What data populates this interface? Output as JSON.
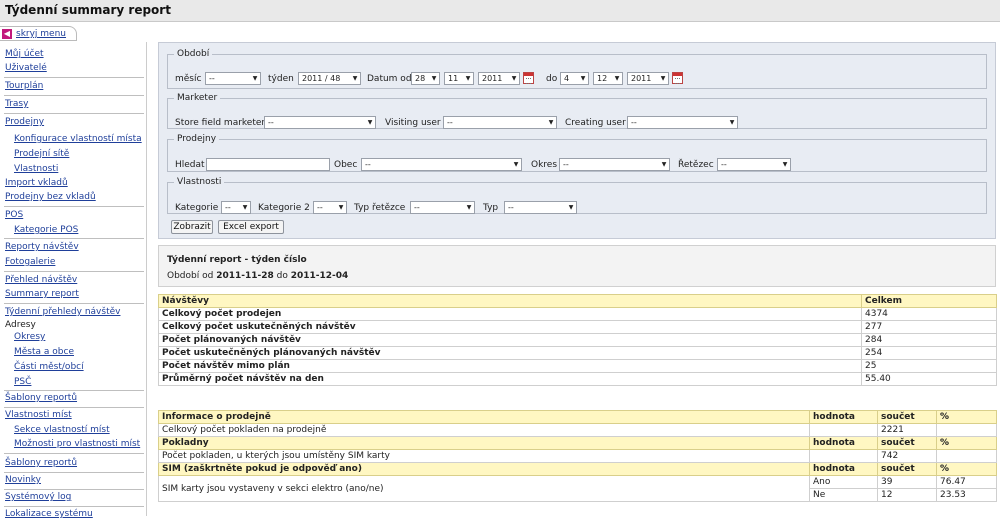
{
  "window": {
    "title": "Týdenní summary report"
  },
  "menu_toggle": {
    "label": "skryj menu"
  },
  "sidebar": {
    "items": [
      "Můj účet",
      "Uživatelé",
      "Tourplán",
      "Trasy",
      "Prodejny",
      "Konfigurace vlastností místa",
      "Prodejní sítě",
      "Vlastnosti",
      "Import vkladů",
      "Prodejny bez vkladů",
      "POS",
      "Kategorie POS",
      "Reporty návštěv",
      "Fotogalerie",
      "Přehled návštěv",
      "Summary report",
      "Týdenní přehledy návštěv",
      "Adresy",
      "Okresy",
      "Města a obce",
      "Části měst/obcí",
      "PSČ",
      "Šablony reportů",
      "Vlastnosti míst",
      "Sekce vlastností míst",
      "Možnosti pro vlastnosti míst",
      "Šablony reportů",
      "Novinky",
      "Systémový log",
      "Lokalizace systému"
    ]
  },
  "filters": {
    "period": {
      "legend": "Období",
      "month_label": "měsíc",
      "month_value": "--",
      "week_label": "týden",
      "week_value": "2011 / 48",
      "date_from_label": "Datum od",
      "from_day": "28",
      "from_month": "11",
      "from_year": "2011",
      "date_to_label": "do",
      "to_day": "4",
      "to_month": "12",
      "to_year": "2011"
    },
    "marketer": {
      "legend": "Marketer",
      "store_label": "Store field marketer",
      "store_value": "--",
      "visiting_label": "Visiting user",
      "visiting_value": "--",
      "creating_label": "Creating user",
      "creating_value": "--"
    },
    "stores": {
      "legend": "Prodejny",
      "search_label": "Hledat",
      "search_value": "",
      "town_label": "Obec",
      "town_value": "--",
      "district_label": "Okres",
      "district_value": "--",
      "chain_label": "Řetězec",
      "chain_value": "--"
    },
    "properties": {
      "legend": "Vlastnosti",
      "cat_label": "Kategorie",
      "cat_value": "--",
      "cat2_label": "Kategorie 2",
      "cat2_value": "--",
      "chain_type_label": "Typ řetězce",
      "chain_type_value": "--",
      "type_label": "Typ",
      "type_value": "--"
    },
    "show_button": "Zobrazit",
    "export_button": "Excel export"
  },
  "report": {
    "heading": "Týdenní report - týden číslo",
    "period_prefix": "Období od",
    "period_from": "2011-11-28",
    "period_mid": "do",
    "period_to": "2011-12-04"
  },
  "visits_table": {
    "header": [
      "Návštěvy",
      "Celkem"
    ],
    "rows": [
      [
        "Celkový počet prodejen",
        "4374"
      ],
      [
        "Celkový počet uskutečněných návštěv",
        "277"
      ],
      [
        "Počet plánovaných návštěv",
        "284"
      ],
      [
        "Počet uskutečněných plánovaných návštěv",
        "254"
      ],
      [
        "Počet návštěv mimo plán",
        "25"
      ],
      [
        "Průměrný počet návštěv na den",
        "55.40"
      ]
    ]
  },
  "info_table": {
    "store_header": [
      "Informace o prodejně",
      "hodnota",
      "součet",
      "%"
    ],
    "store_row": [
      "Celkový počet pokladen na prodejně",
      "",
      "2221",
      ""
    ],
    "pos_header": [
      "Pokladny",
      "hodnota",
      "součet",
      "%"
    ],
    "pos_row": [
      "Počet pokladen, u kterých jsou umístěny SIM karty",
      "",
      "742",
      ""
    ],
    "sim_header": [
      "SIM (zaškrtněte pokud je odpověď ano)",
      "hodnota",
      "součet",
      "%"
    ],
    "sim_label": "SIM karty jsou vystaveny v sekci elektro (ano/ne)",
    "sim_yes": [
      "Ano",
      "39",
      "76.47"
    ],
    "sim_no": [
      "Ne",
      "12",
      "23.53"
    ]
  }
}
